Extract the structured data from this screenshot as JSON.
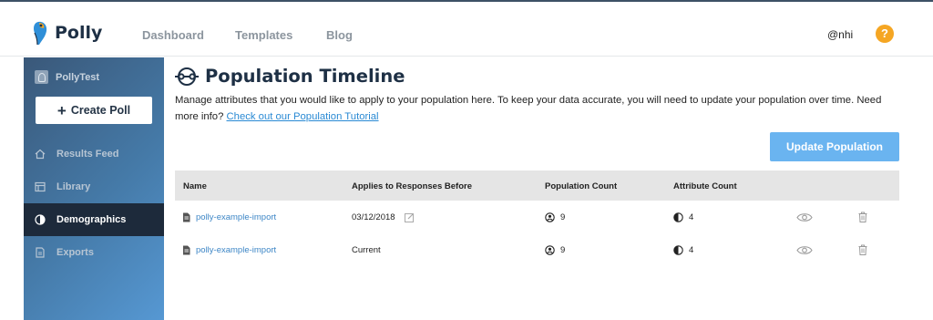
{
  "header": {
    "brand": "Polly",
    "nav": [
      "Dashboard",
      "Templates",
      "Blog"
    ],
    "user": "@nhi",
    "help_icon": "?"
  },
  "sidebar": {
    "workspace": "PollyTest",
    "create_button": "Create Poll",
    "items": [
      {
        "label": "Results Feed",
        "icon": "home-icon",
        "active": false
      },
      {
        "label": "Library",
        "icon": "library-icon",
        "active": false
      },
      {
        "label": "Demographics",
        "icon": "demographics-icon",
        "active": true
      },
      {
        "label": "Exports",
        "icon": "exports-icon",
        "active": false
      }
    ]
  },
  "main": {
    "title": "Population Timeline",
    "description": "Manage attributes that you would like to apply to your population here. To keep your data accurate, you will need to update your population over time. Need more info?",
    "tutorial_link": "Check out our Population Tutorial",
    "update_button": "Update Population",
    "table": {
      "columns": [
        "Name",
        "Applies to Responses Before",
        "Population Count",
        "Attribute Count"
      ],
      "rows": [
        {
          "name": "polly-example-import",
          "applies_before": "03/12/2018",
          "editable": true,
          "population_count": "9",
          "attribute_count": "4"
        },
        {
          "name": "polly-example-import",
          "applies_before": "Current",
          "editable": false,
          "population_count": "9",
          "attribute_count": "4"
        }
      ]
    }
  },
  "colors": {
    "accent": "#6ab4f0",
    "help": "#f5a623",
    "sidebar_active": "#1d2a3b",
    "link": "#3d86c6"
  }
}
